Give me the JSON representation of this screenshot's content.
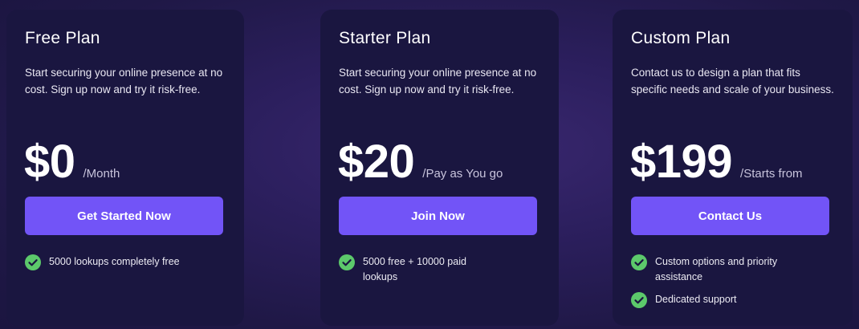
{
  "plans": [
    {
      "title": "Free Plan",
      "description": "Start securing your online presence at no cost. Sign up now and try it risk-free.",
      "price": "$0",
      "period": "/Month",
      "cta_label": "Get Started Now",
      "features": [
        "5000 lookups completely free"
      ]
    },
    {
      "title": "Starter Plan",
      "description": "Start securing your online presence at no cost. Sign up now and try it risk-free.",
      "price": "$20",
      "period": "/Pay as You go",
      "cta_label": "Join Now",
      "features": [
        "5000 free + 10000 paid lookups"
      ]
    },
    {
      "title": "Custom Plan",
      "description": "Contact us to design a plan that fits specific needs and scale of your business.",
      "price": "$199",
      "period": "/Starts from",
      "cta_label": "Contact Us",
      "features": [
        "Custom options and priority assistance",
        "Dedicated support"
      ]
    }
  ],
  "icons": {
    "feature": "check-circle-icon"
  },
  "colors": {
    "accent": "#7254f7",
    "card_background": "#1a1640",
    "check_green": "#5cc96b"
  }
}
